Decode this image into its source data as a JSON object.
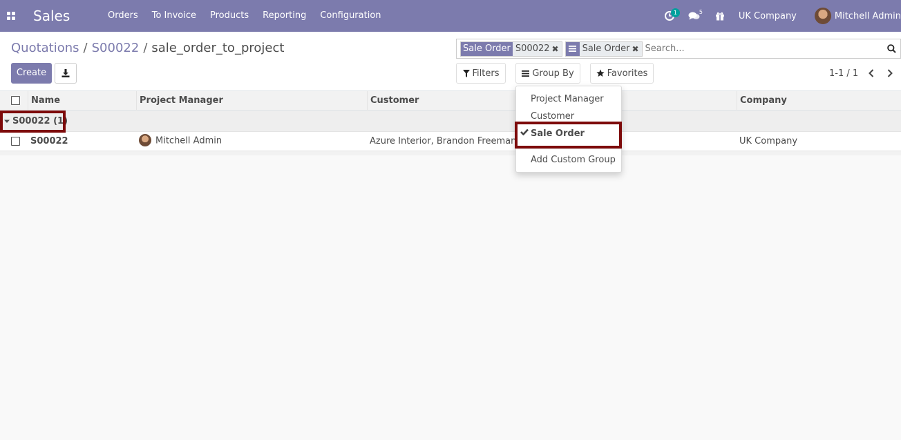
{
  "navbar": {
    "app_name": "Sales",
    "menu": [
      "Orders",
      "To Invoice",
      "Products",
      "Reporting",
      "Configuration"
    ],
    "activity_count": "1",
    "message_count": "5",
    "company": "UK Company",
    "user_name": "Mitchell Admin",
    "brand_color": "#7c7bad"
  },
  "breadcrumb": {
    "items": [
      "Quotations",
      "S00022",
      "sale_order_to_project"
    ],
    "separator": "/"
  },
  "buttons": {
    "create": "Create",
    "filters": "Filters",
    "group_by": "Group By",
    "favorites": "Favorites"
  },
  "search": {
    "facets": [
      {
        "label": "Sale Order",
        "value": "S00022"
      },
      {
        "label": "",
        "value": "Sale Order"
      }
    ],
    "placeholder": "Search..."
  },
  "pager": {
    "value": "1-1 / 1"
  },
  "list": {
    "columns": [
      "Name",
      "Project Manager",
      "Customer",
      "Company"
    ],
    "group": {
      "label": "S00022 (1)"
    },
    "rows": [
      {
        "name": "S00022",
        "project_manager": "Mitchell Admin",
        "customer": "Azure Interior, Brandon Freeman",
        "company": "UK Company"
      }
    ]
  },
  "group_by_menu": {
    "items": [
      "Project Manager",
      "Customer",
      "Sale Order"
    ],
    "selected": "Sale Order",
    "custom": "Add Custom Group"
  },
  "highlight_color": "#7d0a0a"
}
